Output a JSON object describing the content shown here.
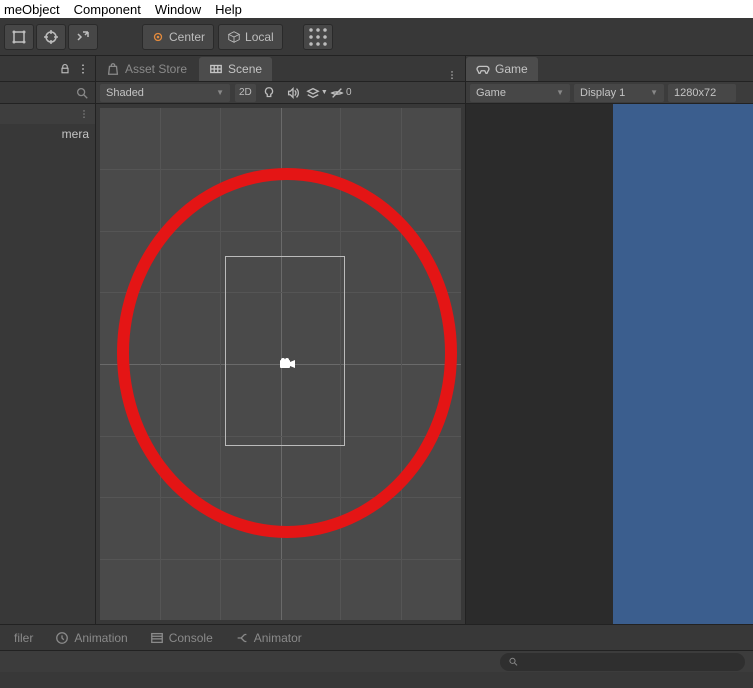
{
  "menu": {
    "gameobject": "meObject",
    "component": "Component",
    "window": "Window",
    "help": "Help"
  },
  "toolbar": {
    "center": "Center",
    "local": "Local"
  },
  "hierarchy": {
    "camera_item": "mera"
  },
  "tabs": {
    "asset_store": "Asset Store",
    "scene": "Scene",
    "game": "Game"
  },
  "scene_toolbar": {
    "shading": "Shaded",
    "twoD": "2D",
    "gizmo_count": "0"
  },
  "game_toolbar": {
    "mode": "Game",
    "display": "Display 1",
    "resolution": "1280x72"
  },
  "bottom_tabs": {
    "profiler": "filer",
    "animation": "Animation",
    "console": "Console",
    "animator": "Animator"
  },
  "search": {
    "placeholder": ""
  }
}
